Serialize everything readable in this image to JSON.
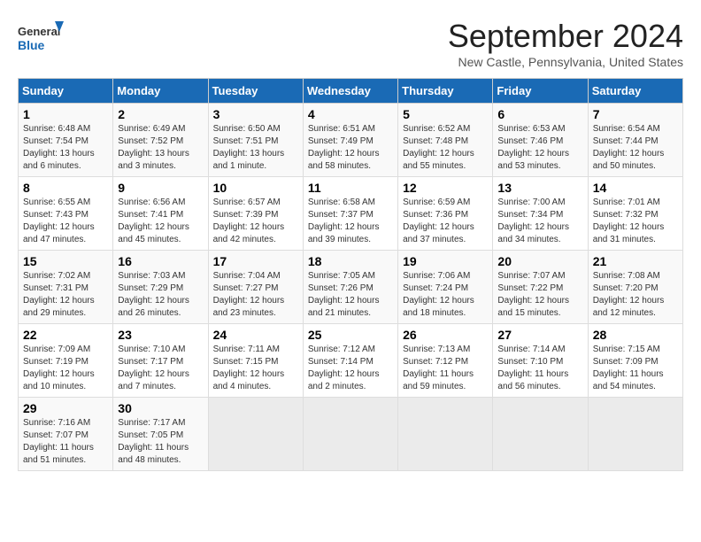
{
  "header": {
    "logo_general": "General",
    "logo_blue": "Blue",
    "month_title": "September 2024",
    "location": "New Castle, Pennsylvania, United States"
  },
  "weekdays": [
    "Sunday",
    "Monday",
    "Tuesday",
    "Wednesday",
    "Thursday",
    "Friday",
    "Saturday"
  ],
  "weeks": [
    [
      {
        "day": "1",
        "sunrise": "6:48 AM",
        "sunset": "7:54 PM",
        "daylight": "13 hours and 6 minutes."
      },
      {
        "day": "2",
        "sunrise": "6:49 AM",
        "sunset": "7:52 PM",
        "daylight": "13 hours and 3 minutes."
      },
      {
        "day": "3",
        "sunrise": "6:50 AM",
        "sunset": "7:51 PM",
        "daylight": "13 hours and 1 minute."
      },
      {
        "day": "4",
        "sunrise": "6:51 AM",
        "sunset": "7:49 PM",
        "daylight": "12 hours and 58 minutes."
      },
      {
        "day": "5",
        "sunrise": "6:52 AM",
        "sunset": "7:48 PM",
        "daylight": "12 hours and 55 minutes."
      },
      {
        "day": "6",
        "sunrise": "6:53 AM",
        "sunset": "7:46 PM",
        "daylight": "12 hours and 53 minutes."
      },
      {
        "day": "7",
        "sunrise": "6:54 AM",
        "sunset": "7:44 PM",
        "daylight": "12 hours and 50 minutes."
      }
    ],
    [
      {
        "day": "8",
        "sunrise": "6:55 AM",
        "sunset": "7:43 PM",
        "daylight": "12 hours and 47 minutes."
      },
      {
        "day": "9",
        "sunrise": "6:56 AM",
        "sunset": "7:41 PM",
        "daylight": "12 hours and 45 minutes."
      },
      {
        "day": "10",
        "sunrise": "6:57 AM",
        "sunset": "7:39 PM",
        "daylight": "12 hours and 42 minutes."
      },
      {
        "day": "11",
        "sunrise": "6:58 AM",
        "sunset": "7:37 PM",
        "daylight": "12 hours and 39 minutes."
      },
      {
        "day": "12",
        "sunrise": "6:59 AM",
        "sunset": "7:36 PM",
        "daylight": "12 hours and 37 minutes."
      },
      {
        "day": "13",
        "sunrise": "7:00 AM",
        "sunset": "7:34 PM",
        "daylight": "12 hours and 34 minutes."
      },
      {
        "day": "14",
        "sunrise": "7:01 AM",
        "sunset": "7:32 PM",
        "daylight": "12 hours and 31 minutes."
      }
    ],
    [
      {
        "day": "15",
        "sunrise": "7:02 AM",
        "sunset": "7:31 PM",
        "daylight": "12 hours and 29 minutes."
      },
      {
        "day": "16",
        "sunrise": "7:03 AM",
        "sunset": "7:29 PM",
        "daylight": "12 hours and 26 minutes."
      },
      {
        "day": "17",
        "sunrise": "7:04 AM",
        "sunset": "7:27 PM",
        "daylight": "12 hours and 23 minutes."
      },
      {
        "day": "18",
        "sunrise": "7:05 AM",
        "sunset": "7:26 PM",
        "daylight": "12 hours and 21 minutes."
      },
      {
        "day": "19",
        "sunrise": "7:06 AM",
        "sunset": "7:24 PM",
        "daylight": "12 hours and 18 minutes."
      },
      {
        "day": "20",
        "sunrise": "7:07 AM",
        "sunset": "7:22 PM",
        "daylight": "12 hours and 15 minutes."
      },
      {
        "day": "21",
        "sunrise": "7:08 AM",
        "sunset": "7:20 PM",
        "daylight": "12 hours and 12 minutes."
      }
    ],
    [
      {
        "day": "22",
        "sunrise": "7:09 AM",
        "sunset": "7:19 PM",
        "daylight": "12 hours and 10 minutes."
      },
      {
        "day": "23",
        "sunrise": "7:10 AM",
        "sunset": "7:17 PM",
        "daylight": "12 hours and 7 minutes."
      },
      {
        "day": "24",
        "sunrise": "7:11 AM",
        "sunset": "7:15 PM",
        "daylight": "12 hours and 4 minutes."
      },
      {
        "day": "25",
        "sunrise": "7:12 AM",
        "sunset": "7:14 PM",
        "daylight": "12 hours and 2 minutes."
      },
      {
        "day": "26",
        "sunrise": "7:13 AM",
        "sunset": "7:12 PM",
        "daylight": "11 hours and 59 minutes."
      },
      {
        "day": "27",
        "sunrise": "7:14 AM",
        "sunset": "7:10 PM",
        "daylight": "11 hours and 56 minutes."
      },
      {
        "day": "28",
        "sunrise": "7:15 AM",
        "sunset": "7:09 PM",
        "daylight": "11 hours and 54 minutes."
      }
    ],
    [
      {
        "day": "29",
        "sunrise": "7:16 AM",
        "sunset": "7:07 PM",
        "daylight": "11 hours and 51 minutes."
      },
      {
        "day": "30",
        "sunrise": "7:17 AM",
        "sunset": "7:05 PM",
        "daylight": "11 hours and 48 minutes."
      },
      null,
      null,
      null,
      null,
      null
    ]
  ]
}
